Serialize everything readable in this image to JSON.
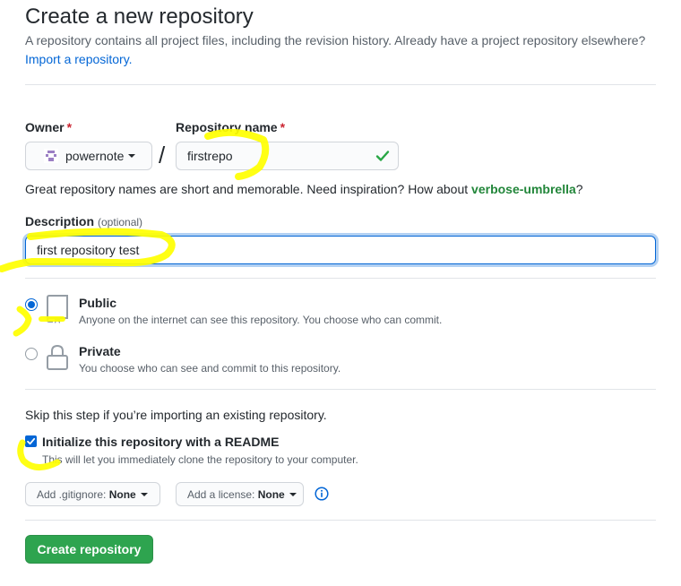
{
  "header": {
    "title": "Create a new repository",
    "subtitle_text": "A repository contains all project files, including the revision history. Already have a project repository elsewhere?",
    "import_link": "Import a repository."
  },
  "owner": {
    "label": "Owner",
    "required_mark": "*",
    "value": "powernote"
  },
  "slash": "/",
  "repo_name": {
    "label": "Repository name",
    "required_mark": "*",
    "value": "firstrepo"
  },
  "hint": {
    "prefix": "Great repository names are short and memorable. Need inspiration? How about ",
    "suggestion": "verbose-umbrella",
    "suffix": "?"
  },
  "description": {
    "label": "Description",
    "optional": "(optional)",
    "value": "first repository test"
  },
  "visibility": {
    "public": {
      "title": "Public",
      "desc": "Anyone on the internet can see this repository. You choose who can commit.",
      "checked": true
    },
    "private": {
      "title": "Private",
      "desc": "You choose who can see and commit to this repository.",
      "checked": false
    }
  },
  "init": {
    "skip_text": "Skip this step if you’re importing an existing repository.",
    "readme_label": "Initialize this repository with a README",
    "readme_desc": "This will let you immediately clone the repository to your computer.",
    "readme_checked": true
  },
  "dropdowns": {
    "gitignore_label": "Add .gitignore:",
    "gitignore_value": "None",
    "license_label": "Add a license:",
    "license_value": "None"
  },
  "submit_label": "Create repository",
  "colors": {
    "link": "#0366d6",
    "primary_button": "#2ea44f",
    "required": "#cb2431",
    "success_check": "#28a745",
    "highlighter": "#ffff00"
  },
  "icons": {
    "owner_avatar": "identicon",
    "valid": "check-icon",
    "public": "repo-icon",
    "private": "lock-icon",
    "info": "info-icon"
  }
}
